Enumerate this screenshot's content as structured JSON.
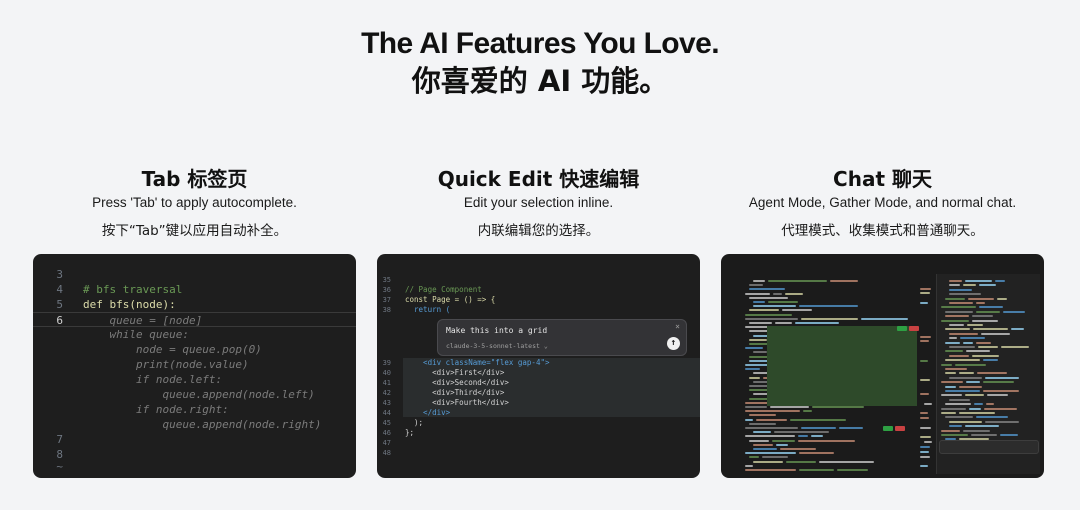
{
  "hero": {
    "title": "The AI Features You Love.",
    "subtitle": "你喜爱的 AI 功能。"
  },
  "features": [
    {
      "title": "Tab  标签页",
      "desc": "Press 'Tab' to apply autocomplete.",
      "desc_cn": "按下“Tab”键以应用自动补全。"
    },
    {
      "title": "Quick Edit  快速编辑",
      "desc": "Edit your selection inline.",
      "desc_cn": "内联编辑您的选择。"
    },
    {
      "title": "Chat  聊天",
      "desc": "Agent Mode, Gather Mode, and normal chat.",
      "desc_cn": "代理模式、收集模式和普通聊天。"
    }
  ],
  "tab_demo": {
    "lines": [
      {
        "n": "3",
        "t": ""
      },
      {
        "n": "4",
        "t": "# bfs traversal"
      },
      {
        "n": "5",
        "t": "def bfs(node):"
      },
      {
        "n": "6",
        "t": "    queue = [node]"
      },
      {
        "n": "",
        "t": "    while queue:"
      },
      {
        "n": "",
        "t": "        node = queue.pop(0)"
      },
      {
        "n": "",
        "t": "        print(node.value)"
      },
      {
        "n": "",
        "t": "        if node.left:"
      },
      {
        "n": "",
        "t": "            queue.append(node.left)"
      },
      {
        "n": "",
        "t": "        if node.right:"
      },
      {
        "n": "",
        "t": "            queue.append(node.right)"
      },
      {
        "n": "7",
        "t": ""
      },
      {
        "n": "8",
        "t": ""
      },
      {
        "n": "~",
        "t": ""
      }
    ]
  },
  "quick_edit_demo": {
    "lines_top": [
      {
        "n": "35",
        "t": ""
      },
      {
        "n": "36",
        "t": "// Page Component"
      },
      {
        "n": "37",
        "t": "const Page = () => {"
      },
      {
        "n": "38",
        "t": "  return ("
      }
    ],
    "lines_bottom": [
      {
        "n": "39",
        "t": "    <div className=\"flex gap-4\">"
      },
      {
        "n": "40",
        "t": "      <div>First</div>"
      },
      {
        "n": "41",
        "t": "      <div>Second</div>"
      },
      {
        "n": "42",
        "t": "      <div>Third</div>"
      },
      {
        "n": "43",
        "t": "      <div>Fourth</div>"
      },
      {
        "n": "44",
        "t": "    </div>"
      },
      {
        "n": "45",
        "t": "  );"
      },
      {
        "n": "46",
        "t": "};"
      },
      {
        "n": "47",
        "t": ""
      },
      {
        "n": "48",
        "t": ""
      }
    ],
    "prompt": "Make this into a grid",
    "model": "claude-3-5-sonnet-latest ⌄",
    "close": "×",
    "send": "↑"
  }
}
